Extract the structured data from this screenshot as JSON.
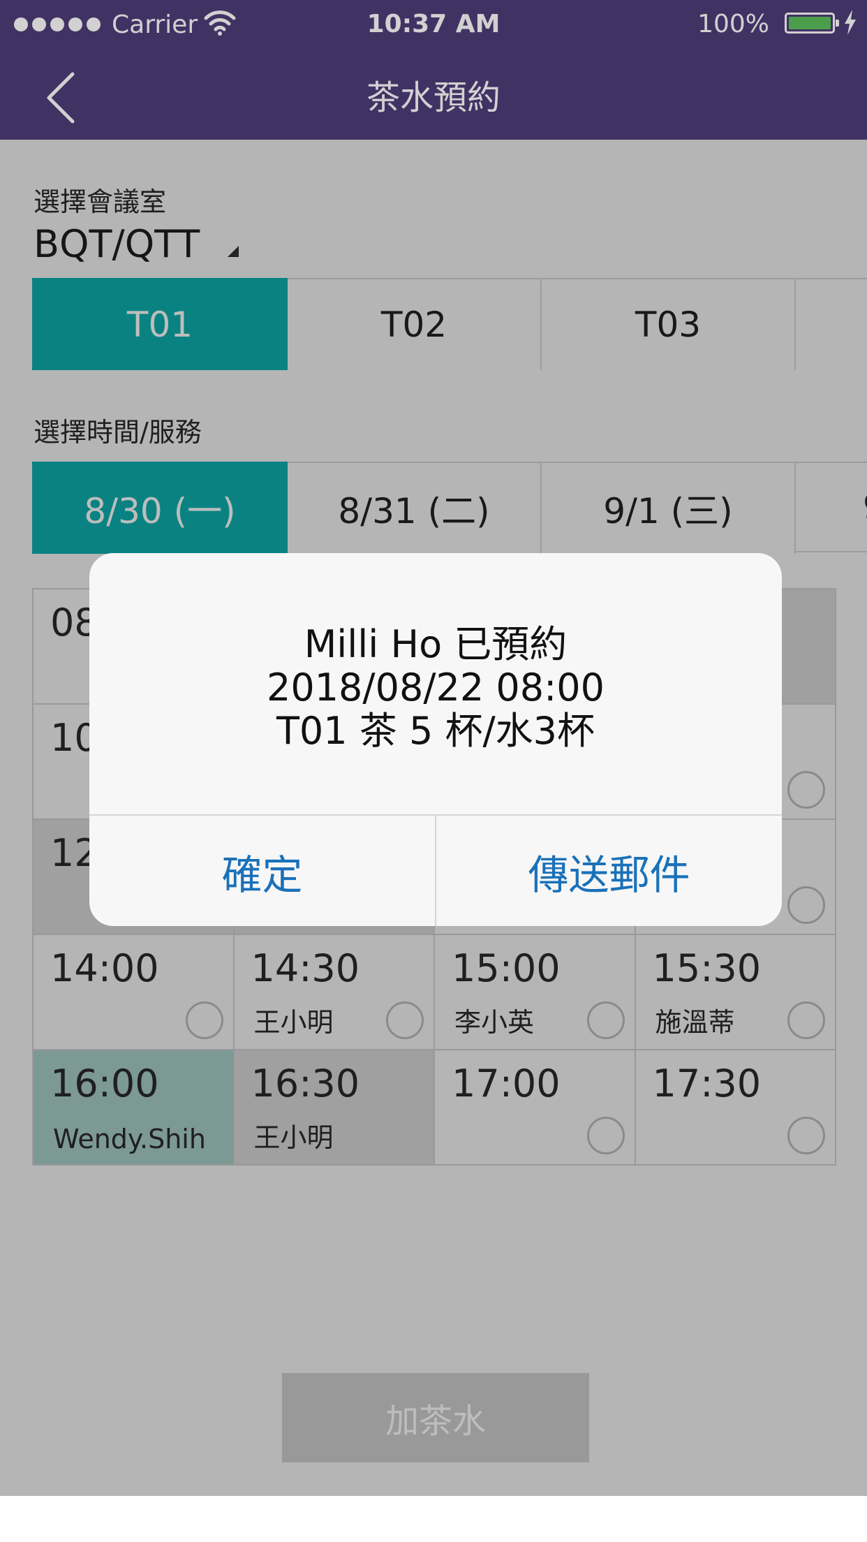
{
  "status_bar": {
    "carrier": "Carrier",
    "time": "10:37 AM",
    "battery": "100%",
    "signal_icon": "signal-dots-icon",
    "wifi_icon": "wifi-icon",
    "battery_icon": "battery-icon",
    "charging_icon": "charging-bolt-icon"
  },
  "nav": {
    "title": "茶水預約",
    "back_icon": "chevron-left-icon"
  },
  "room": {
    "label": "選擇會議室",
    "selected": "BQT/QTT",
    "caret_icon": "dropdown-caret-icon",
    "tabs": [
      "T01",
      "T02",
      "T03",
      ""
    ]
  },
  "time_service": {
    "label": "選擇時間/服務",
    "dates": [
      "8/30 (一)",
      "8/31 (二)",
      "9/1 (三)",
      "9"
    ]
  },
  "slots": [
    {
      "time": "08",
      "name": "",
      "state": "free"
    },
    {
      "time": "",
      "name": "",
      "state": "free"
    },
    {
      "time": "",
      "name": "",
      "state": "free"
    },
    {
      "time": "",
      "name": "",
      "state": "booked"
    },
    {
      "time": "10",
      "name": "",
      "state": "free"
    },
    {
      "time": "",
      "name": "",
      "state": "free"
    },
    {
      "time": "",
      "name": "",
      "state": "free"
    },
    {
      "time": "",
      "name": "",
      "state": "free"
    },
    {
      "time": "12",
      "name": "",
      "state": "booked"
    },
    {
      "time": "",
      "name": "",
      "state": "booked"
    },
    {
      "time": "",
      "name": "",
      "state": "free"
    },
    {
      "time": "",
      "name": "",
      "state": "free"
    },
    {
      "time": "14:00",
      "name": "",
      "state": "free"
    },
    {
      "time": "14:30",
      "name": "王小明",
      "state": "free"
    },
    {
      "time": "15:00",
      "name": "李小英",
      "state": "free"
    },
    {
      "time": "15:30",
      "name": "施溫蒂",
      "state": "free"
    },
    {
      "time": "16:00",
      "name": "Wendy.Shih",
      "state": "mine"
    },
    {
      "time": "16:30",
      "name": "王小明",
      "state": "booked"
    },
    {
      "time": "17:00",
      "name": "",
      "state": "free"
    },
    {
      "time": "17:30",
      "name": "",
      "state": "free"
    }
  ],
  "add_button": "加茶水",
  "dialog": {
    "line1": "Milli Ho 已預約",
    "line2": "2018/08/22 08:00",
    "line3": "T01 茶 5 杯/水3杯",
    "confirm": "確定",
    "send_mail": "傳送郵件"
  },
  "colors": {
    "header": "#503d7a",
    "accent": "#0eb0b0",
    "dialog_button_text": "#1a71b9",
    "mine_slot": "#a8cfc7"
  }
}
